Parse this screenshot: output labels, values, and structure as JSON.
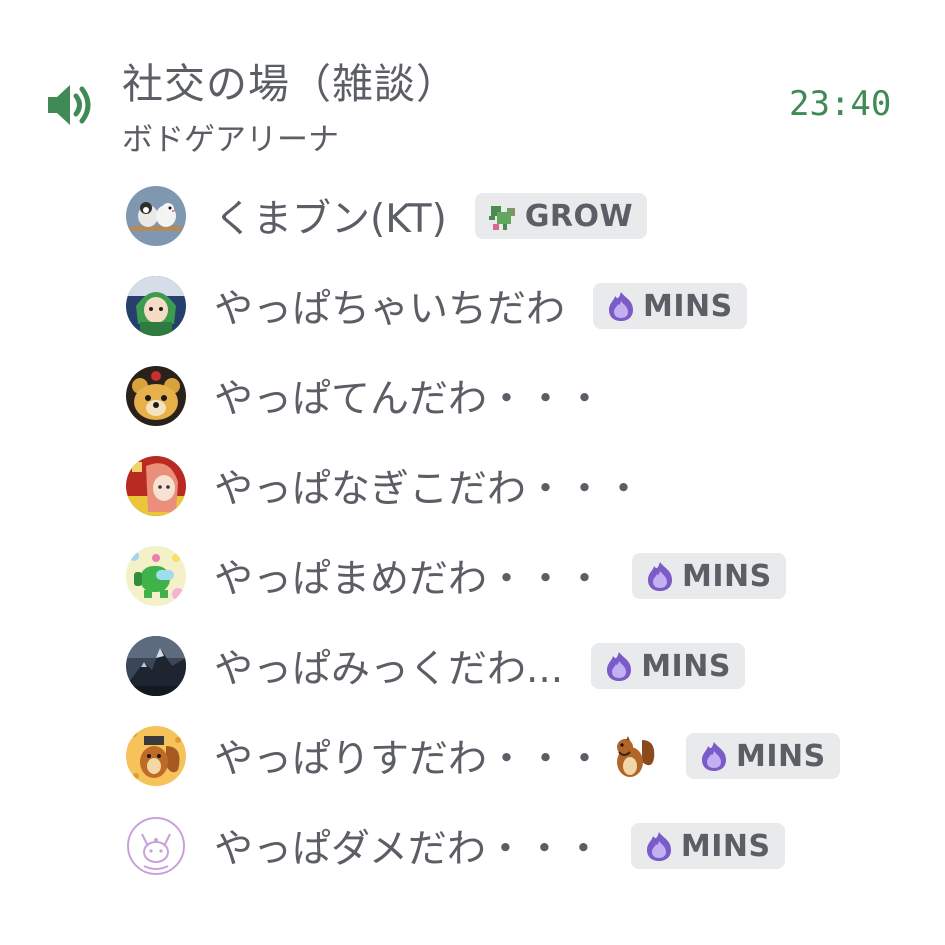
{
  "channel": {
    "name": "社交の場（雑談）",
    "subtitle": "ボドゲアリーナ",
    "timer": "23:40",
    "icon": "speaker-icon",
    "accent_color": "#3f8a55"
  },
  "members": [
    {
      "name": "くまブン(KT)",
      "avatar": "birds-avatar",
      "tag": {
        "label": "GROW",
        "icon": "dragon-icon"
      }
    },
    {
      "name": "やっぱちゃいちだわ",
      "avatar": "green-hair-avatar",
      "tag": {
        "label": "MINS",
        "icon": "purple-flame-icon"
      }
    },
    {
      "name": "やっぱてんだわ・・・",
      "avatar": "bear-cake-avatar"
    },
    {
      "name": "やっぱなぎこだわ・・・",
      "avatar": "red-hair-avatar"
    },
    {
      "name": "やっぱまめだわ・・・",
      "avatar": "green-crewmate-avatar",
      "tag": {
        "label": "MINS",
        "icon": "purple-flame-icon"
      }
    },
    {
      "name": "やっぱみっくだわ...",
      "avatar": "mountain-avatar",
      "tag": {
        "label": "MINS",
        "icon": "purple-flame-icon"
      }
    },
    {
      "name": "やっぱりすだわ・・・",
      "avatar": "squirrel-avatar",
      "emoji": "chipmunk-emoji",
      "tag": {
        "label": "MINS",
        "icon": "purple-flame-icon"
      }
    },
    {
      "name": "やっぱダメだわ・・・",
      "avatar": "espeon-outline-avatar",
      "tag": {
        "label": "MINS",
        "icon": "purple-flame-icon"
      }
    }
  ]
}
